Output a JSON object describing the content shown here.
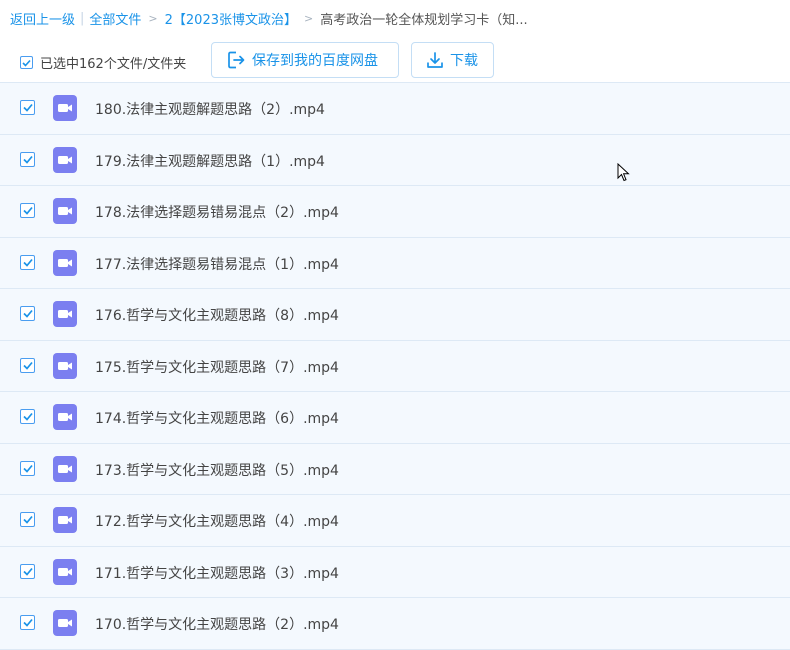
{
  "breadcrumb": {
    "back": "返回上一级",
    "separator": "|",
    "all_files": "全部文件",
    "arrow": ">",
    "folder": "2【2023张博文政治】",
    "current": "高考政治一轮全体规划学习卡（知..."
  },
  "toolbar": {
    "selected_text": "已选中162个文件/文件夹",
    "save_label": "保存到我的百度网盘",
    "download_label": "下载",
    "save_icon": "save-to-disk-icon",
    "download_icon": "download-icon"
  },
  "files": [
    {
      "name": "180.法律主观题解题思路（2）.mp4",
      "checked": true
    },
    {
      "name": "179.法律主观题解题思路（1）.mp4",
      "checked": true
    },
    {
      "name": "178.法律选择题易错易混点（2）.mp4",
      "checked": true
    },
    {
      "name": "177.法律选择题易错易混点（1）.mp4",
      "checked": true
    },
    {
      "name": "176.哲学与文化主观题思路（8）.mp4",
      "checked": true
    },
    {
      "name": "175.哲学与文化主观题思路（7）.mp4",
      "checked": true
    },
    {
      "name": "174.哲学与文化主观题思路（6）.mp4",
      "checked": true
    },
    {
      "name": "173.哲学与文化主观题思路（5）.mp4",
      "checked": true
    },
    {
      "name": "172.哲学与文化主观题思路（4）.mp4",
      "checked": true
    },
    {
      "name": "171.哲学与文化主观题思路（3）.mp4",
      "checked": true
    },
    {
      "name": "170.哲学与文化主观题思路（2）.mp4",
      "checked": true
    }
  ],
  "colors": {
    "accent": "#1a93e8",
    "video_icon": "#7b7ff0",
    "row_bg": "#f4f9fe"
  }
}
